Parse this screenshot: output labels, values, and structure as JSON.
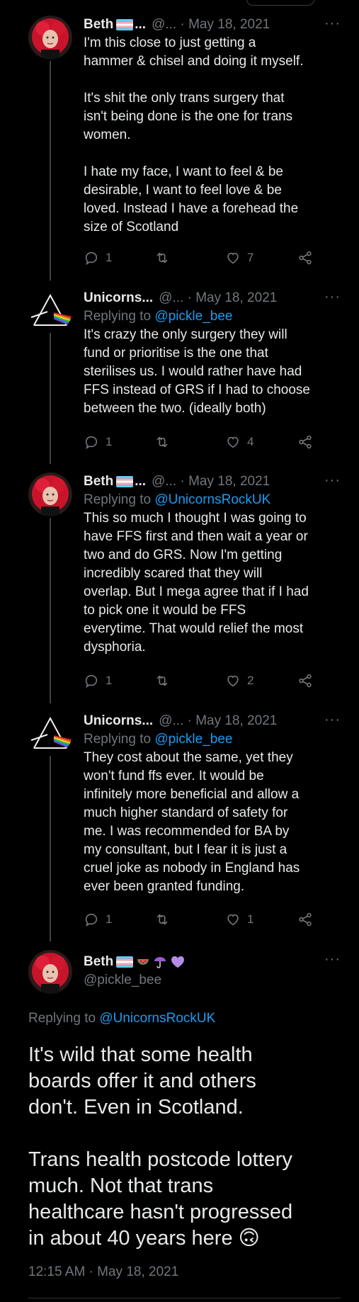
{
  "tweets": [
    {
      "name": "Beth",
      "meta": "@... · May 18, 2021",
      "more": "···",
      "reply_prefix": "",
      "reply_handle": "",
      "text": "I'm this close to just getting a\nhammer & chisel and doing it myself.\n\nIt's shit the only trans surgery that\nisn't being done is the one for trans\nwomen.\n\nI hate my face, I want to feel & be\ndesirable, I want to feel love & be\nloved. Instead I have a forehead the\nsize of Scotland",
      "replies": "1",
      "likes": "7"
    },
    {
      "name": "Unicorns...",
      "meta": "@... · May 18, 2021",
      "more": "···",
      "reply_prefix": "Replying to ",
      "reply_handle": "@pickle_bee",
      "text": "It's crazy the only surgery they will\nfund or prioritise is the one that\nsterilises us. I would rather have had\nFFS instead of GRS if I had to choose\nbetween the two. (ideally both)",
      "replies": "1",
      "likes": "4"
    },
    {
      "name": "Beth",
      "meta": "@... · May 18, 2021",
      "more": "···",
      "reply_prefix": "Replying to ",
      "reply_handle": "@UnicornsRockUK",
      "text": "This so much I thought I was going to\nhave FFS first and then wait a year or\ntwo and do GRS. Now I'm getting\nincredibly scared that they will\noverlap. But I mega agree that if I had\nto pick one it would be FFS\neverytime. That would relief the most\ndysphoria.",
      "replies": "1",
      "likes": "2"
    },
    {
      "name": "Unicorns...",
      "meta": "@... · May 18, 2021",
      "more": "···",
      "reply_prefix": "Replying to ",
      "reply_handle": "@pickle_bee",
      "text": "They cost about the same, yet they\nwon't fund ffs ever. It would be\ninfinitely more beneficial and allow a\nmuch higher standard of safety for\nme. I was recommended for BA by\nmy consultant, but I fear it is just a\ncruel joke as nobody in England has\never been granted funding.",
      "replies": "1",
      "likes": "1"
    }
  ],
  "main": {
    "name": "Beth",
    "handle": "@pickle_bee",
    "more": "···",
    "reply_prefix": "Replying to ",
    "reply_handle": "@UnicornsRockUK",
    "text": "It's wild that some health\nboards offer it and others\ndon't. Even in Scotland.\n\nTrans health postcode lottery\nmuch. Not that trans\nhealthcare hasn't progressed\nin about 40 years here",
    "emoji": "🙃",
    "time": "12:15 AM · May 18, 2021"
  },
  "colors": {
    "background": "#000000",
    "text": "#e7e9ea",
    "muted": "#71767b",
    "link": "#1d9bf0",
    "divider": "#2f3336"
  },
  "icons": [
    "reply-icon",
    "retweet-icon",
    "like-icon",
    "share-icon",
    "trans-flag-icon",
    "watermelon-icon",
    "umbrella-icon",
    "heart-icon",
    "prism-icon"
  ]
}
